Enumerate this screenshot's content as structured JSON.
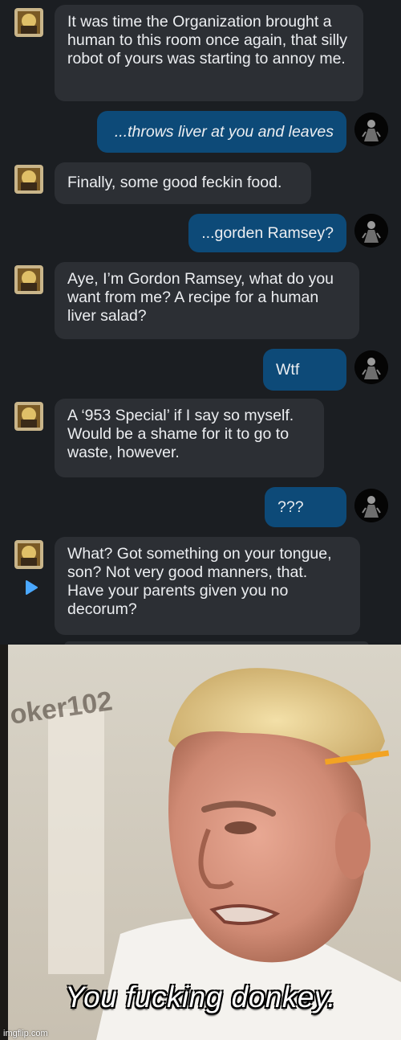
{
  "chat": {
    "messages": [
      {
        "role": "bot",
        "text": "It was time the Organization brought a human to this room once again, that silly robot of yours was starting to annoy me."
      },
      {
        "role": "user",
        "text": "...throws liver at you and leaves"
      },
      {
        "role": "bot",
        "text": "Finally, some good feckin food."
      },
      {
        "role": "user",
        "text": "...gorden Ramsey?"
      },
      {
        "role": "bot",
        "text": "Aye, I’m Gordon Ramsey, what do you want from me? A recipe for a human liver salad?"
      },
      {
        "role": "user",
        "text": "Wtf"
      },
      {
        "role": "bot",
        "text": "A ‘953 Special’ if I say so myself. Would be a shame for it to go to waste, however."
      },
      {
        "role": "user",
        "text": "???"
      },
      {
        "role": "bot",
        "text": "What? Got something on your tongue, son? Not very good manners, that. Have your parents given you no decorum?"
      }
    ],
    "colors": {
      "background": "#1b1e22",
      "bot_bubble": "#2c2f34",
      "user_bubble": "#0d4a78",
      "text": "#eceef1"
    }
  },
  "meme": {
    "caption": "You fucking donkey.",
    "watermark": "oker102",
    "credit": "imgflip.com"
  }
}
